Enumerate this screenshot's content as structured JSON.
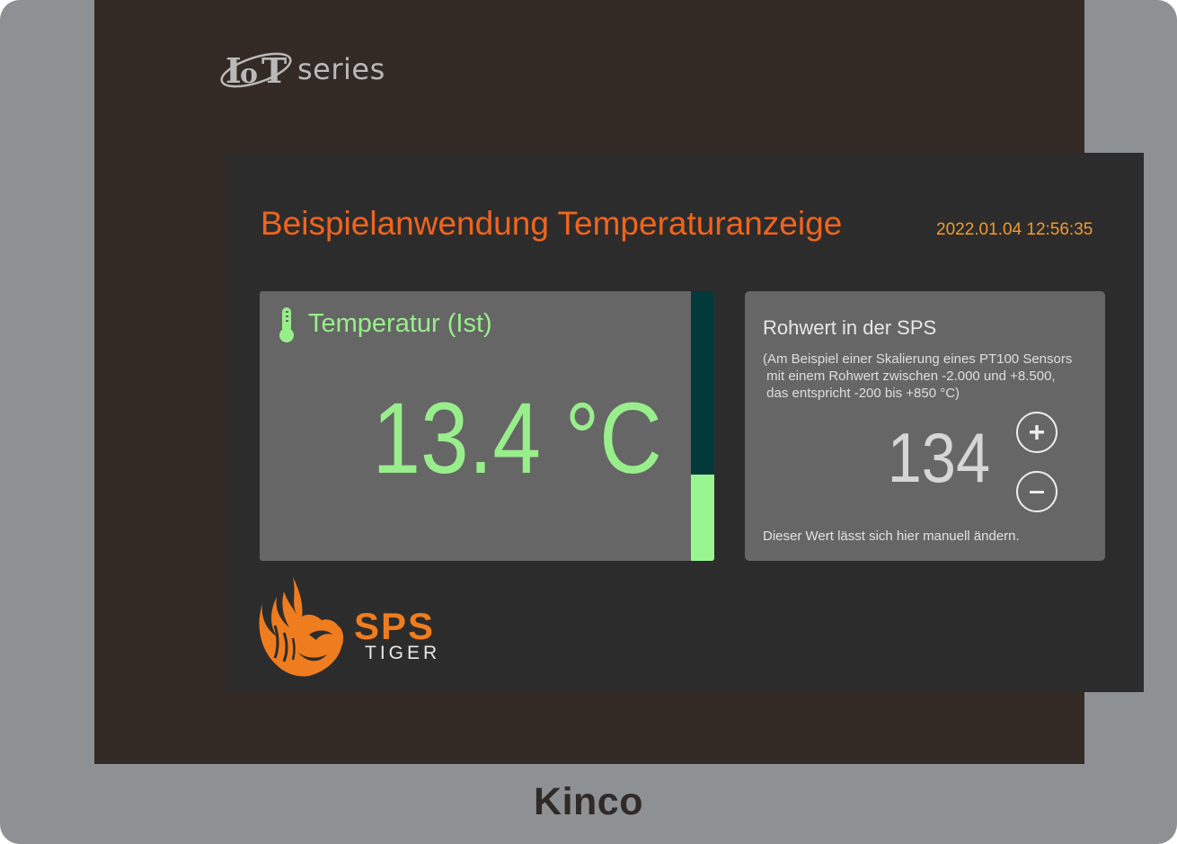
{
  "brand": {
    "series": "series",
    "manufacturer": "Kinco"
  },
  "app": {
    "title": "Beispielanwendung Temperaturanzeige",
    "datetime": "2022.01.04 12:56:35"
  },
  "temperature": {
    "label": "Temperatur (Ist)",
    "display": "13.4 °C",
    "bar_fill_fraction": 0.32,
    "colors": {
      "value": "#99ee8c",
      "bar_fill": "#99f590",
      "bar_track": "#023a3c"
    },
    "icon": "thermometer-icon"
  },
  "raw": {
    "title": "Rohwert in der SPS",
    "description": "(Am Beispiel einer Skalierung eines PT100 Sensors\n mit einem Rohwert zwischen -2.000 und +8.500,\n das entspricht -200 bis +850 °C)",
    "value": "134",
    "note": "Dieser Wert lässt sich hier manuell ändern.",
    "increment_icon": "plus-icon",
    "decrement_icon": "minus-icon"
  },
  "logo": {
    "sps": "SPS",
    "tiger": "TIGER"
  },
  "colors": {
    "title": "#f0641e",
    "datetime": "#f19a32",
    "panel": "#666666",
    "screen": "#2c2c2c",
    "bezel": "#342a25"
  }
}
